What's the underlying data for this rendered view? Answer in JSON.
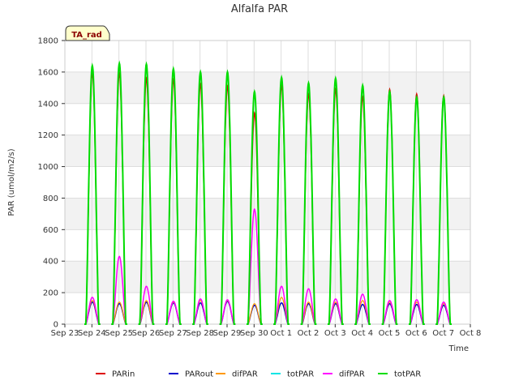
{
  "chart_data": {
    "type": "line",
    "title": "Alfalfa PAR",
    "xlabel": "Time",
    "ylabel": "PAR (umol/m2/s)",
    "ylim": [
      0,
      1800
    ],
    "yticks": [
      0,
      200,
      400,
      600,
      800,
      1000,
      1200,
      1400,
      1600,
      1800
    ],
    "xlim": [
      0,
      15
    ],
    "xticks": [
      {
        "x": 0,
        "label": "Sep 23"
      },
      {
        "x": 1,
        "label": "Sep 24"
      },
      {
        "x": 2,
        "label": "Sep 25"
      },
      {
        "x": 3,
        "label": "Sep 26"
      },
      {
        "x": 4,
        "label": "Sep 27"
      },
      {
        "x": 5,
        "label": "Sep 28"
      },
      {
        "x": 6,
        "label": "Sep 29"
      },
      {
        "x": 7,
        "label": "Sep 30"
      },
      {
        "x": 8,
        "label": "Oct 1"
      },
      {
        "x": 9,
        "label": "Oct 2"
      },
      {
        "x": 10,
        "label": "Oct 3"
      },
      {
        "x": 11,
        "label": "Oct 4"
      },
      {
        "x": 12,
        "label": "Oct 5"
      },
      {
        "x": 13,
        "label": "Oct 6"
      },
      {
        "x": 14,
        "label": "Oct 7"
      },
      {
        "x": 15,
        "label": "Oct 8"
      }
    ],
    "annotation": "TA_rad",
    "grid": true,
    "legend_position": "bottom",
    "daylight_window": [
      0.27,
      0.76
    ],
    "series": [
      {
        "name": "PARin",
        "color": "#dd0000",
        "width": 1.5,
        "daily_peaks": [
          1590,
          1590,
          1560,
          1550,
          1520,
          1510,
          1340,
          1510,
          1460,
          1490,
          1440,
          1490,
          1460,
          1450
        ]
      },
      {
        "name": "PARout",
        "color": "#0000cc",
        "width": 1.5,
        "daily_peaks": [
          140,
          130,
          140,
          135,
          135,
          145,
          120,
          135,
          130,
          130,
          125,
          130,
          125,
          120
        ]
      },
      {
        "name": "difPAR",
        "color": "#ff9900",
        "width": 1.2,
        "daily_peaks": [
          150,
          140,
          150,
          140,
          150,
          150,
          130,
          170,
          140,
          140,
          150,
          140,
          140,
          130
        ]
      },
      {
        "name": "totPAR",
        "color": "#00e5e5",
        "width": 1.2,
        "daily_peaks": [
          1620,
          1630,
          1630,
          1600,
          1580,
          1580,
          1460,
          1550,
          1510,
          1540,
          1500,
          1460,
          1430,
          1430
        ]
      },
      {
        "name": "difPAR",
        "color": "#ff00ff",
        "width": 1.5,
        "daily_peaks": [
          170,
          430,
          240,
          145,
          160,
          155,
          730,
          240,
          225,
          160,
          190,
          150,
          155,
          140
        ]
      },
      {
        "name": "totPAR",
        "color": "#00dd00",
        "width": 2,
        "daily_peaks": [
          1640,
          1655,
          1650,
          1620,
          1600,
          1600,
          1475,
          1565,
          1530,
          1560,
          1515,
          1475,
          1440,
          1440
        ]
      }
    ]
  }
}
